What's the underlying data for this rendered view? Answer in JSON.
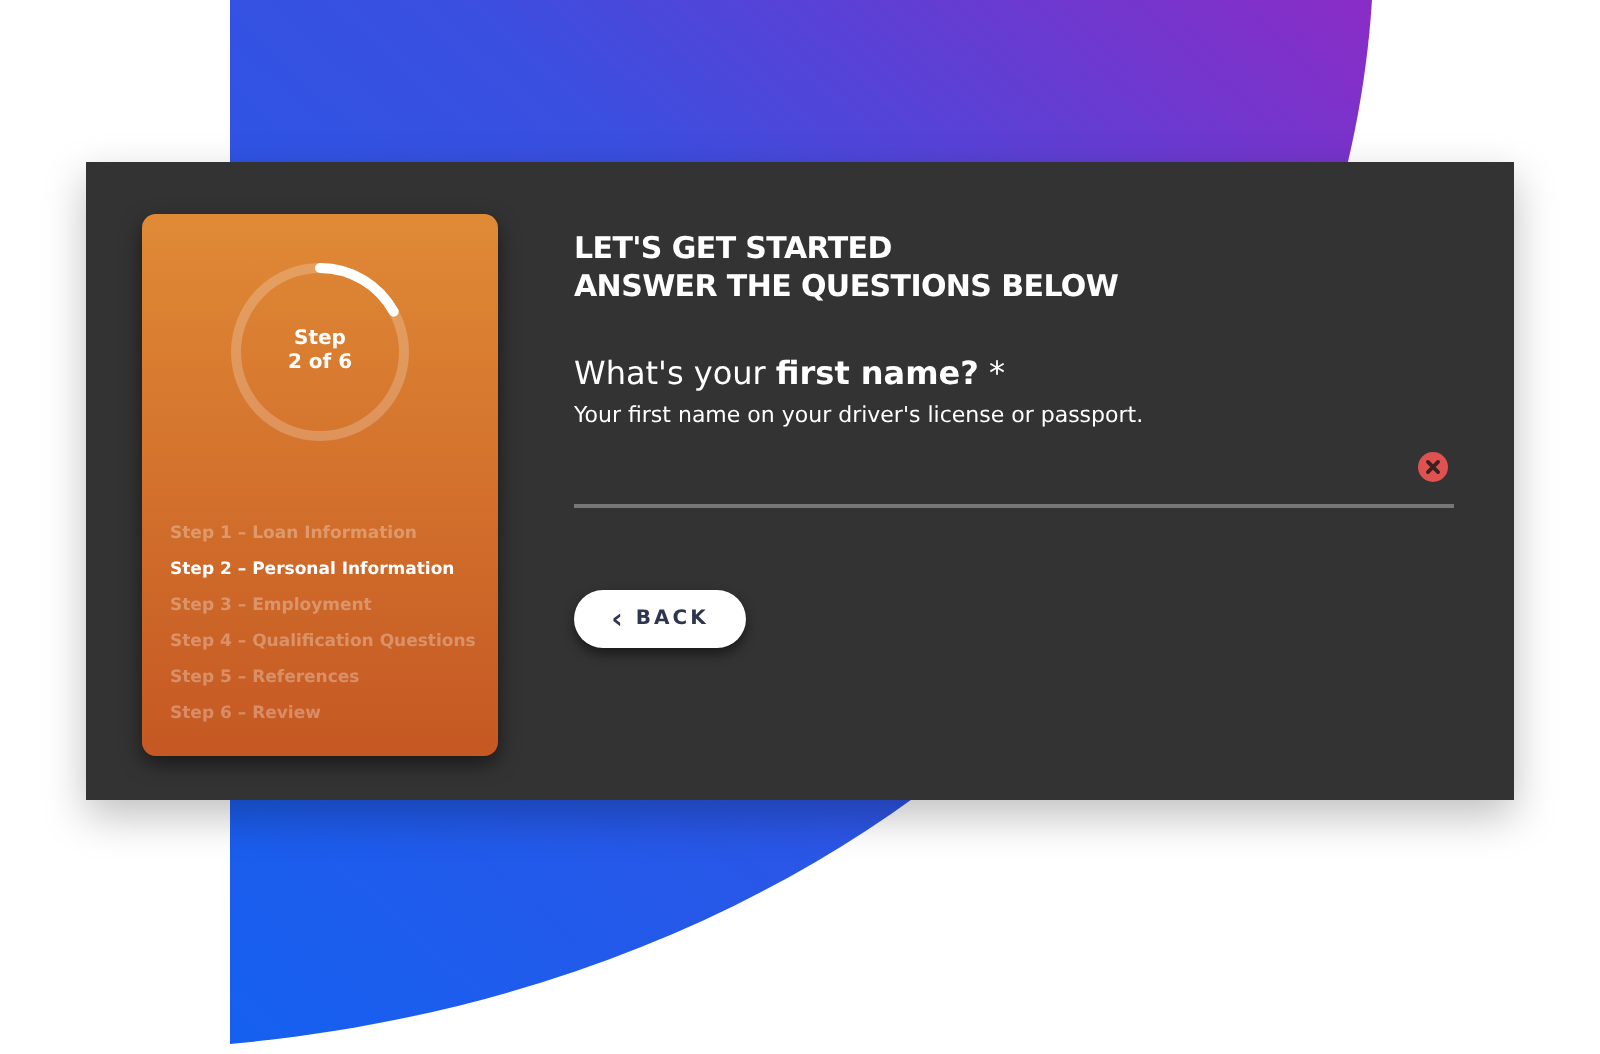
{
  "progress": {
    "label_line_1": "Step",
    "label_line_2": "2 of 6"
  },
  "steps": [
    {
      "label": "Step 1 – Loan Information",
      "selected": false
    },
    {
      "label": "Step 2 – Personal Information",
      "selected": true
    },
    {
      "label": "Step 3 – Employment",
      "selected": false
    },
    {
      "label": "Step 4 – Qualification Questions",
      "selected": false
    },
    {
      "label": "Step 5 – References",
      "selected": false
    },
    {
      "label": "Step 6 – Review",
      "selected": false
    }
  ],
  "heading": [
    "LET'S GET STARTED",
    "ANSWER THE QUESTIONS BELOW"
  ],
  "question": {
    "label": "What's your **first name?** *",
    "hint": "Your first name on your driver's license or passport.",
    "invalid": true
  },
  "back_button": {
    "icon": "‹",
    "label": "BACK"
  }
}
